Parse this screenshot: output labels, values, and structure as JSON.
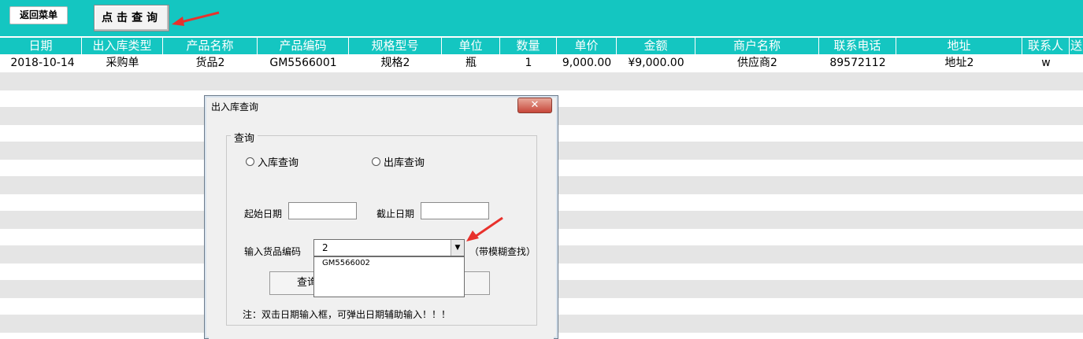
{
  "toolbar": {
    "back_label": "返回菜单",
    "query_label": "点击查询"
  },
  "table": {
    "columns": [
      "日期",
      "出入库类型",
      "产品名称",
      "产品编码",
      "规格型号",
      "单位",
      "数量",
      "单价",
      "金额",
      "商户名称",
      "联系电话",
      "地址",
      "联系人",
      "送"
    ],
    "rows": [
      [
        "2018-10-14",
        "采购单",
        "货品2",
        "GM5566001",
        "规格2",
        "瓶",
        "1",
        "9,000.00",
        "¥9,000.00",
        "供应商2",
        "89572112",
        "地址2",
        "w",
        ""
      ]
    ]
  },
  "dialog": {
    "title": "出入库查询",
    "close_label": "✕",
    "group_title": "查询",
    "radio_in": "入库查询",
    "radio_out": "出库查询",
    "start_date_label": "起始日期",
    "end_date_label": "截止日期",
    "code_label": "输入货品编码",
    "code_value": "2",
    "fuzzy_hint": "（带模糊查找）",
    "dropdown_options": [
      "GM5566002"
    ],
    "query_button_label": "查询",
    "note": "注：双击日期输入框，可弹出日期辅助输入！！！"
  },
  "colors": {
    "accent": "#14c6c1",
    "stripe": "#e5e5e5",
    "arrow": "#e8312c"
  }
}
